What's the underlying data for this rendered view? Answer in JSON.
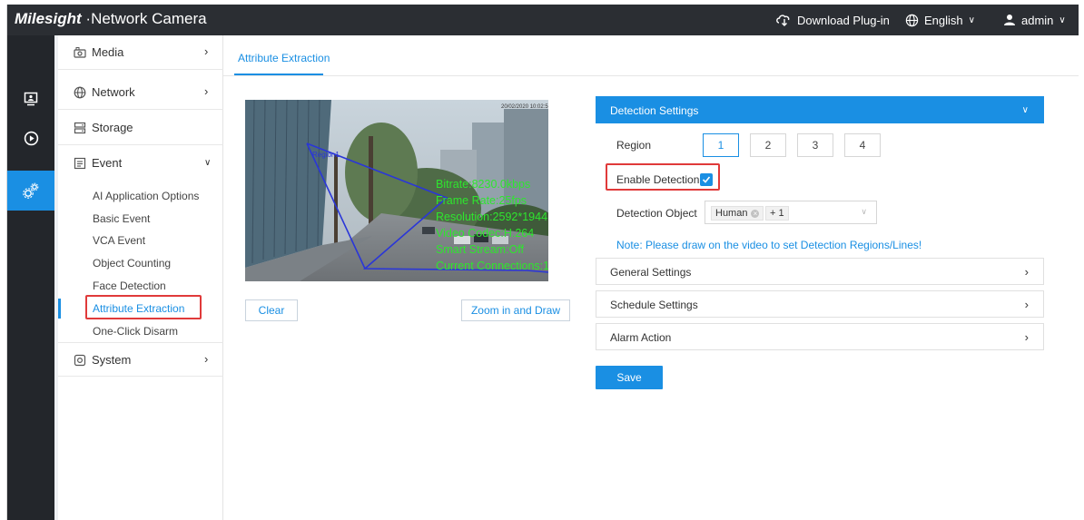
{
  "header": {
    "brand": "Milesight",
    "product": "Network Camera",
    "download_plugin": "Download Plug-in",
    "language": "English",
    "user": "admin"
  },
  "sidebar": {
    "items": [
      {
        "label": "Media"
      },
      {
        "label": "Network"
      },
      {
        "label": "Storage"
      },
      {
        "label": "Event"
      },
      {
        "label": "System"
      }
    ],
    "event_subitems": [
      "AI Application Options",
      "Basic Event",
      "VCA Event",
      "Object Counting",
      "Face Detection",
      "Attribute Extraction",
      "One-Click Disarm"
    ]
  },
  "main": {
    "tab": "Attribute Extraction",
    "video": {
      "timestamp": "20/02/2020 10:02:50",
      "region_label": "Region1",
      "overlay_lines": [
        "Bitrate:8230.0kbps",
        "Frame Rate:25fps",
        "Resolution:2592*1944",
        "Video Codec:H.264",
        "Smart Stream:Off",
        "Current Connections:1"
      ]
    },
    "clear_button": "Clear",
    "zoom_button": "Zoom in and Draw",
    "detection": {
      "title": "Detection Settings",
      "region_label": "Region",
      "regions": [
        "1",
        "2",
        "3",
        "4"
      ],
      "selected_region": "1",
      "enable_label": "Enable Detection",
      "enable_checked": true,
      "object_label": "Detection Object",
      "object_tag": "Human",
      "object_more": "+ 1",
      "note": "Note: Please draw on the video to set Detection Regions/Lines!"
    },
    "sections": [
      {
        "label": "General Settings"
      },
      {
        "label": "Schedule Settings"
      },
      {
        "label": "Alarm Action"
      }
    ],
    "save_button": "Save"
  },
  "colors": {
    "accent": "#1a8fe3",
    "topbar": "#2b2e33",
    "rail": "#23262b",
    "highlight": "#e03a3a",
    "overlay_text": "#2ee62e",
    "region_line": "#2a36d8"
  }
}
